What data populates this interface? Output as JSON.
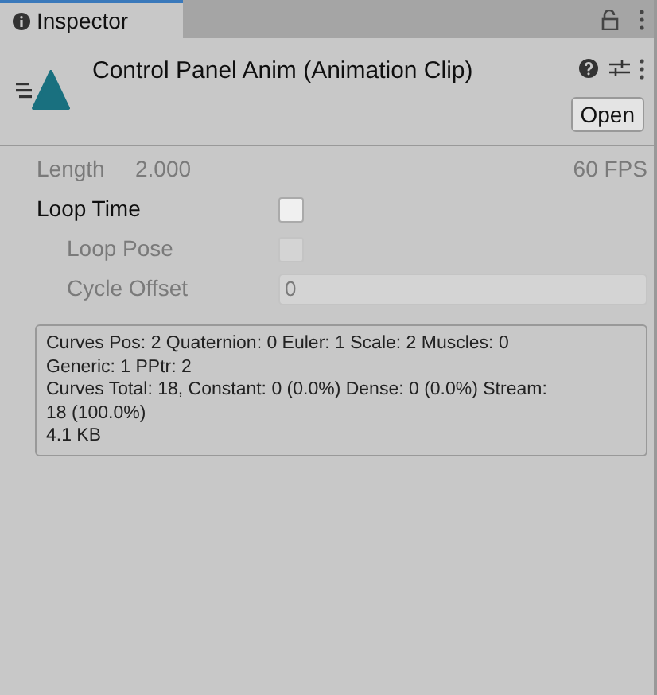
{
  "tab": {
    "label": "Inspector",
    "selected": true
  },
  "header": {
    "title": "Control Panel Anim (Animation Clip)",
    "open_button": "Open"
  },
  "length": {
    "label": "Length",
    "value": "2.000",
    "fps": "60 FPS"
  },
  "fields": [
    {
      "kind": "checkbox",
      "label": "Loop Time",
      "checked": false,
      "disabled": false,
      "indented": false
    },
    {
      "kind": "checkbox",
      "label": "Loop Pose",
      "checked": false,
      "disabled": true,
      "indented": true
    },
    {
      "kind": "number",
      "label": "Cycle Offset",
      "value": "0",
      "disabled": true,
      "indented": true
    }
  ],
  "info_lines": [
    "Curves Pos: 2 Quaternion: 0 Euler: 1 Scale: 2 Muscles: 0",
    "Generic: 1 PPtr: 2",
    "Curves Total: 18, Constant: 0 (0.0%) Dense: 0 (0.0%) Stream:",
    "18 (100.0%)",
    "4.1 KB"
  ]
}
